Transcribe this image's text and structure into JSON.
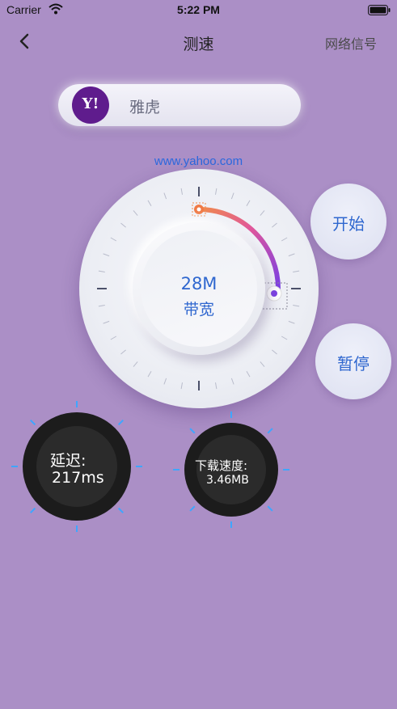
{
  "status_bar": {
    "carrier": "Carrier",
    "time": "5:22 PM"
  },
  "nav": {
    "title": "测速",
    "right_label": "网络信号",
    "back_icon": "chevron-left-icon"
  },
  "site": {
    "logo_text": "Y!",
    "name": "雅虎",
    "url": "www.yahoo.com"
  },
  "speed_dial": {
    "value": "28M",
    "label": "带宽",
    "arc_colors": [
      "#f08a4b",
      "#e0579b",
      "#7b3fe4"
    ]
  },
  "buttons": {
    "start": "开始",
    "pause": "暂停"
  },
  "latency": {
    "label": "延迟:",
    "value": "217ms"
  },
  "download": {
    "label": "下载速度:",
    "value": "3.46MB"
  },
  "colors": {
    "background": "#ab8fc6",
    "accent_blue": "#2f67cf",
    "gauge_tick": "#3fa6ff"
  }
}
